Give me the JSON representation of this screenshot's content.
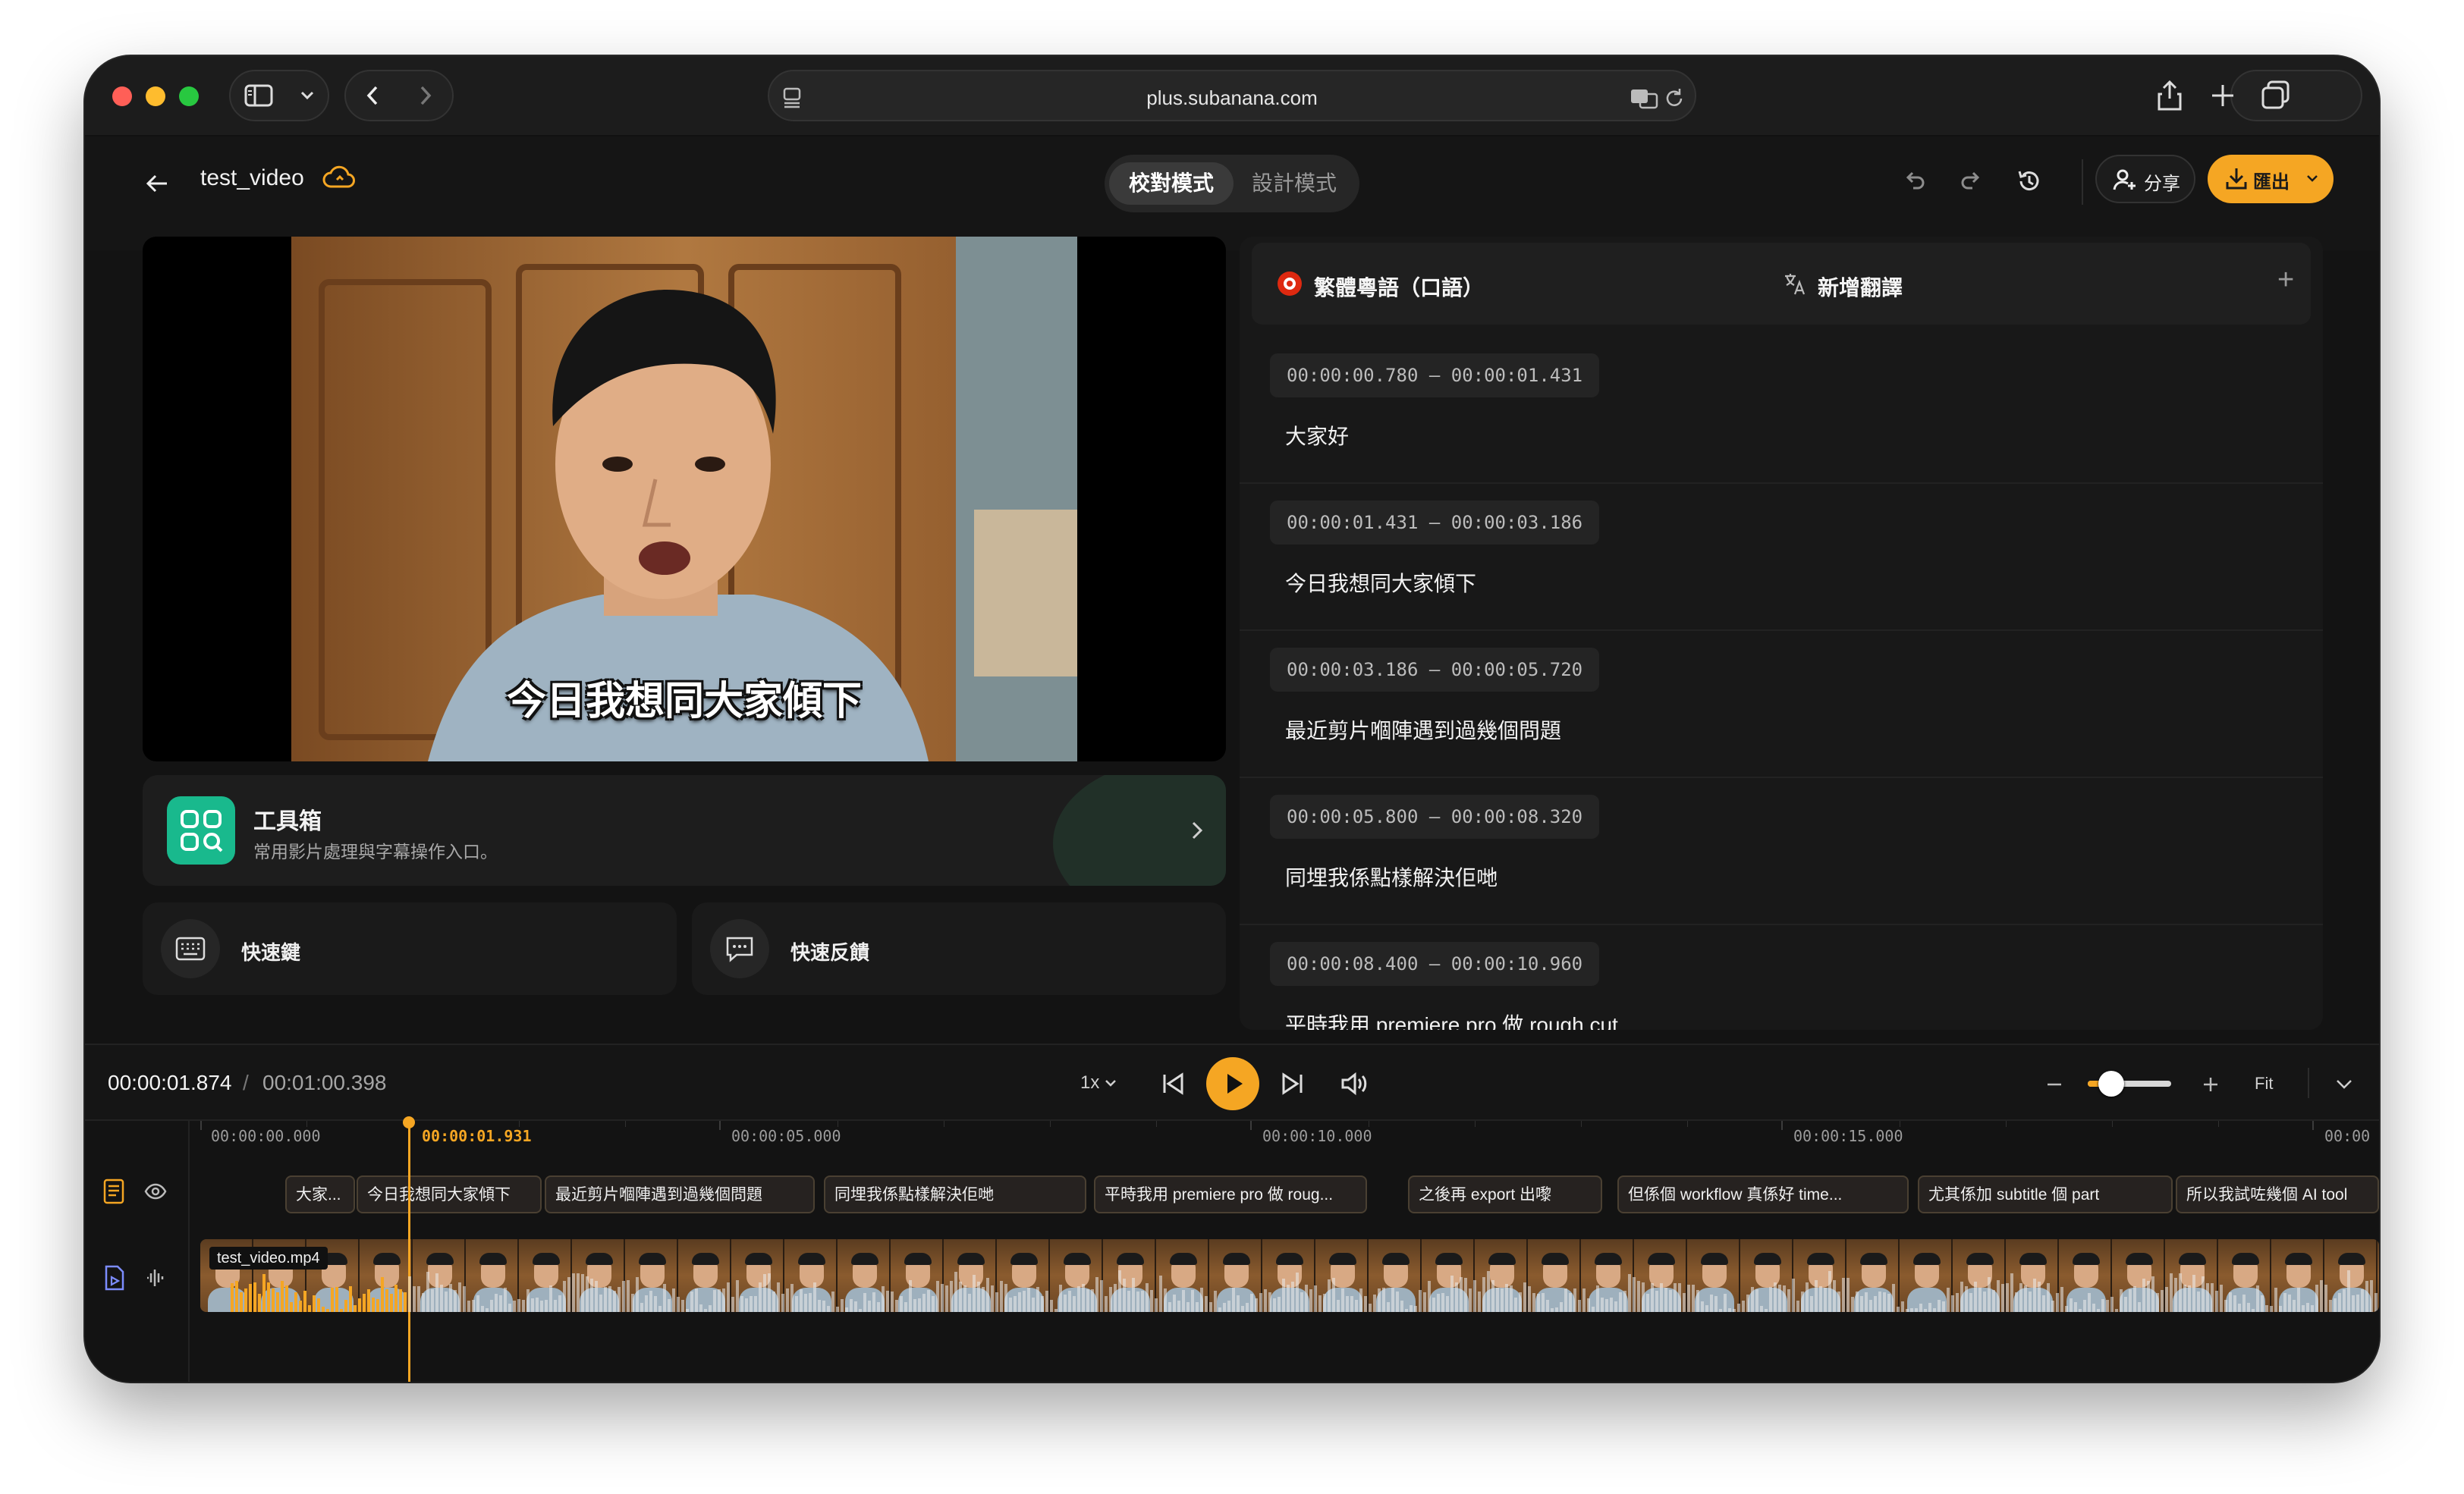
{
  "browser": {
    "url": "plus.subanana.com"
  },
  "header": {
    "project_name": "test_video",
    "mode_proofread": "校對模式",
    "mode_design": "設計模式",
    "share_label": "分享",
    "export_label": "匯出"
  },
  "video": {
    "burned_subtitle": "今日我想同大家傾下"
  },
  "toolbox": {
    "title": "工具箱",
    "subtitle": "常用影片處理與字幕操作入口。"
  },
  "cards": {
    "shortcuts": "快速鍵",
    "feedback": "快速反饋"
  },
  "transcript": {
    "language_tab": "繁體粵語（口語）",
    "add_translation": "新增翻譯",
    "add_icon": "+",
    "segments": [
      {
        "time": "00:00:00.780 – 00:00:01.431",
        "text": "大家好"
      },
      {
        "time": "00:00:01.431 – 00:00:03.186",
        "text": "今日我想同大家傾下"
      },
      {
        "time": "00:00:03.186 – 00:00:05.720",
        "text": "最近剪片嗰陣遇到過幾個問題"
      },
      {
        "time": "00:00:05.800 – 00:00:08.320",
        "text": "同埋我係點樣解決佢哋"
      },
      {
        "time": "00:00:08.400 – 00:00:10.960",
        "text": "平時我用 premiere pro 做 rough cut"
      }
    ]
  },
  "player": {
    "current_time": "00:00:01.874",
    "separator": "/",
    "total_time": "00:01:00.398",
    "speed": "1x",
    "zoom_level": 0.2,
    "fit_label": "Fit"
  },
  "timeline": {
    "ruler": [
      "00:00:00.000",
      "00:00:01.931",
      "00:00:05.000",
      "00:00:10.000",
      "00:00:15.000",
      "00:00"
    ],
    "subtitle_clips": [
      "大家...",
      "今日我想同大家傾下",
      "最近剪片嗰陣遇到過幾個問題",
      "同埋我係點樣解決佢哋",
      "平時我用 premiere pro 做 roug...",
      "之後再 export 出嚟",
      "但係個 workflow 真係好 time...",
      "尤其係加 subtitle 個 part",
      "所以我試咗幾個 AI tool"
    ],
    "video_file": "test_video.mp4"
  },
  "colors": {
    "accent": "#f5a623",
    "toolbox_icon": "#19b98d",
    "background": "#131313"
  }
}
